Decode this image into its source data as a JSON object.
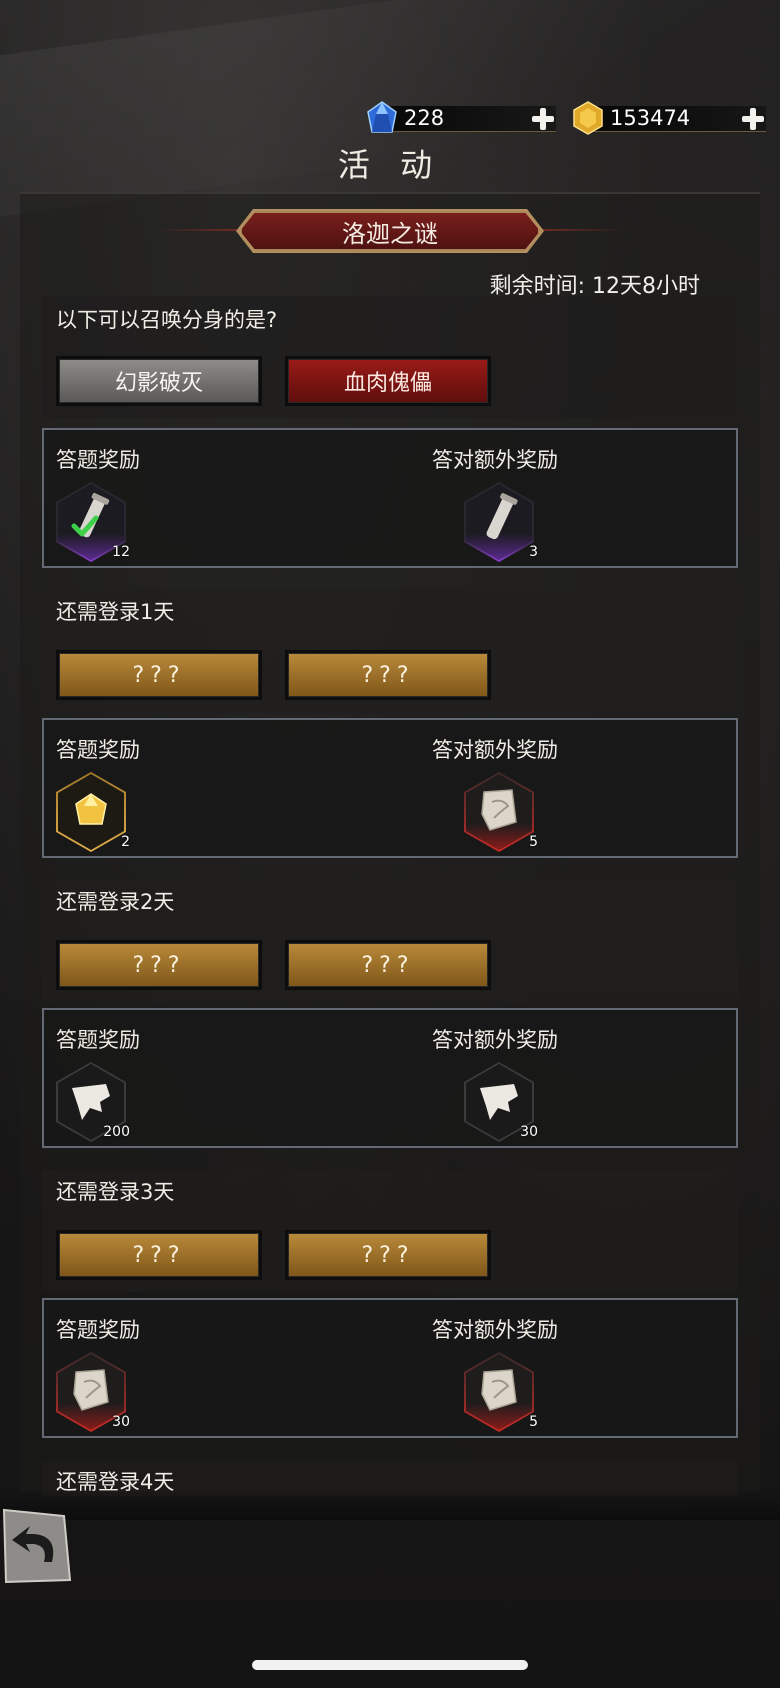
{
  "currency": {
    "gems": "228",
    "gold": "153474"
  },
  "header": {
    "title": "活 动"
  },
  "event": {
    "banner": "洛迦之谜",
    "remaining": "剩余时间: 12天8小时"
  },
  "labels": {
    "answer_reward": "答题奖励",
    "extra_reward": "答对额外奖励"
  },
  "question": {
    "text": "以下可以召唤分身的是?",
    "options": [
      "幻影破灭",
      "血肉傀儡"
    ]
  },
  "rewards": [
    {
      "answer": {
        "icon": "scroll-icon",
        "count": "12"
      },
      "extra": {
        "icon": "scroll-icon",
        "count": "3"
      }
    },
    {
      "answer": {
        "icon": "gold-crystal-icon",
        "count": "2"
      },
      "extra": {
        "icon": "parchment-icon",
        "count": "5"
      }
    },
    {
      "answer": {
        "icon": "torn-paper-icon",
        "count": "200"
      },
      "extra": {
        "icon": "torn-paper-icon",
        "count": "30"
      }
    },
    {
      "answer": {
        "icon": "parchment-icon",
        "count": "30"
      },
      "extra": {
        "icon": "parchment-icon",
        "count": "5"
      }
    }
  ],
  "locked": [
    {
      "title": "还需登录1天",
      "options": [
        "???",
        "???"
      ]
    },
    {
      "title": "还需登录2天",
      "options": [
        "???",
        "???"
      ]
    },
    {
      "title": "还需登录3天",
      "options": [
        "???",
        "???"
      ]
    },
    {
      "title": "还需登录4天"
    }
  ],
  "colors": {
    "accent_red": "#8a1a17",
    "accent_gold": "#b98a3a",
    "border": "#646a74"
  }
}
